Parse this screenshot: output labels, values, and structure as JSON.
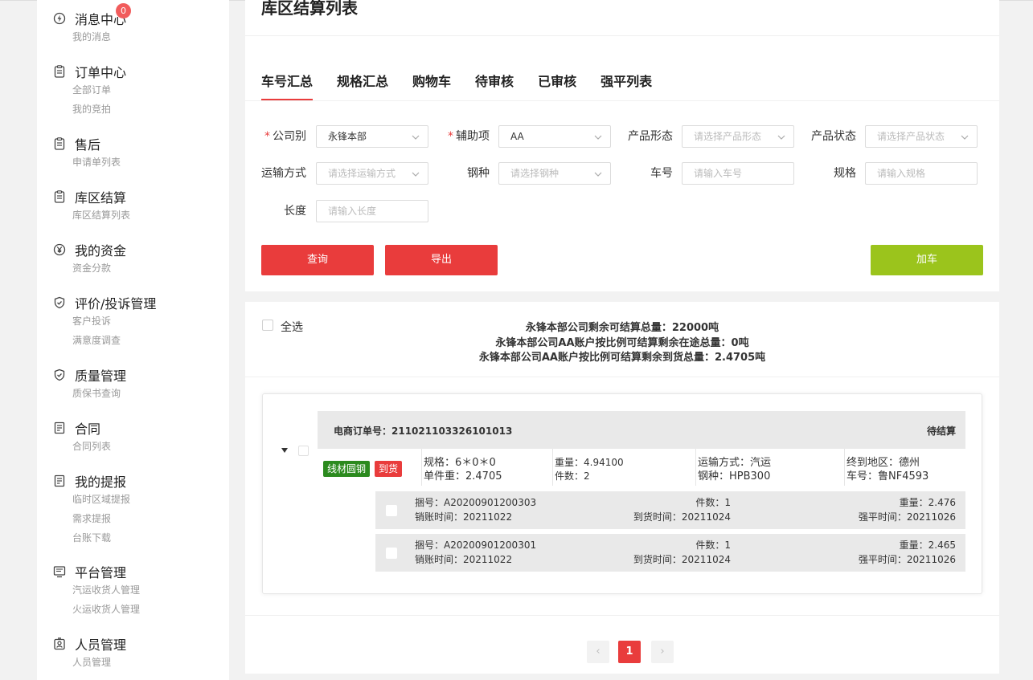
{
  "sidebar": {
    "groups": [
      {
        "title": "消息中心",
        "icon": "bolt-circle-icon",
        "badge": "0",
        "items": [
          "我的消息"
        ]
      },
      {
        "title": "订单中心",
        "icon": "clipboard-icon",
        "items": [
          "全部订单",
          "我的竞拍"
        ]
      },
      {
        "title": "售后",
        "icon": "clipboard-icon",
        "items": [
          "申请单列表"
        ]
      },
      {
        "title": "库区结算",
        "icon": "clipboard-icon",
        "items": [
          "库区结算列表"
        ]
      },
      {
        "title": "我的资金",
        "icon": "yen-circle-icon",
        "items": [
          "资金分款"
        ]
      },
      {
        "title": "评价/投诉管理",
        "icon": "shield-check-icon",
        "items": [
          "客户投诉",
          "满意度调查"
        ]
      },
      {
        "title": "质量管理",
        "icon": "shield-check-icon",
        "items": [
          "质保书查询"
        ]
      },
      {
        "title": "合同",
        "icon": "document-icon",
        "items": [
          "合同列表"
        ]
      },
      {
        "title": "我的提报",
        "icon": "document-icon",
        "items": [
          "临时区域提报",
          "需求提报",
          "台账下载"
        ]
      },
      {
        "title": "平台管理",
        "icon": "monitor-icon",
        "items": [
          "汽运收货人管理",
          "火运收货人管理"
        ]
      },
      {
        "title": "人员管理",
        "icon": "id-badge-icon",
        "items": [
          "人员管理"
        ]
      }
    ]
  },
  "page": {
    "title": "库区结算列表"
  },
  "tabs": [
    "车号汇总",
    "规格汇总",
    "购物车",
    "待审核",
    "已审核",
    "强平列表"
  ],
  "filters": {
    "company": {
      "label": "公司别",
      "value": "永锋本部"
    },
    "aux": {
      "label": "辅助项",
      "value": "AA"
    },
    "form": {
      "label": "产品形态",
      "placeholder": "请选择产品形态"
    },
    "status": {
      "label": "产品状态",
      "placeholder": "请选择产品状态"
    },
    "transport": {
      "label": "运输方式",
      "placeholder": "请选择运输方式"
    },
    "steel": {
      "label": "钢种",
      "placeholder": "请选择钢种"
    },
    "car": {
      "label": "车号",
      "placeholder": "请输入车号"
    },
    "spec": {
      "label": "规格",
      "placeholder": "请输入规格"
    },
    "length": {
      "label": "长度",
      "placeholder": "请输入长度"
    }
  },
  "buttons": {
    "query": "查询",
    "export": "导出",
    "add_cart": "加车"
  },
  "list": {
    "select_all": "全选",
    "summary": [
      "永锋本部公司剩余可结算总量：22000吨",
      "永锋本部公司AA账户按比例可结算剩余在途总量：0吨",
      "永锋本部公司AA账户按比例可结算剩余到货总量：2.4705吨"
    ],
    "order": {
      "no": "电商订单号：211021103326101013",
      "status": "待结算",
      "tag_product": "线材圆钢",
      "tag_arrival": "到货",
      "spec": "规格：6＊0＊0",
      "unit_weight": "单件重：2.4705",
      "weight": "重量：4.94100",
      "pieces": "件数：2",
      "transport": "运输方式：汽运",
      "steel": "钢种：HPB300",
      "dest": "终到地区：德州",
      "car": "车号：鲁NF4593",
      "bundles": [
        {
          "no": "捆号：A20200901200303",
          "sale_time": "销账时间：20211022",
          "pieces": "件数：1",
          "arrive_time": "到货时间：20211024",
          "weight": "重量：2.476",
          "force_time": "强平时间：20211026"
        },
        {
          "no": "捆号：A20200901200301",
          "sale_time": "销账时间：20211022",
          "pieces": "件数：1",
          "arrive_time": "到货时间：20211024",
          "weight": "重量：2.465",
          "force_time": "强平时间：20211026"
        }
      ]
    }
  },
  "pagination": {
    "current": "1",
    "prev": "‹",
    "next": "›"
  },
  "colors": {
    "accent": "#e93c3c",
    "green": "#9bc41c",
    "tag_green": "#2b8a1e"
  }
}
